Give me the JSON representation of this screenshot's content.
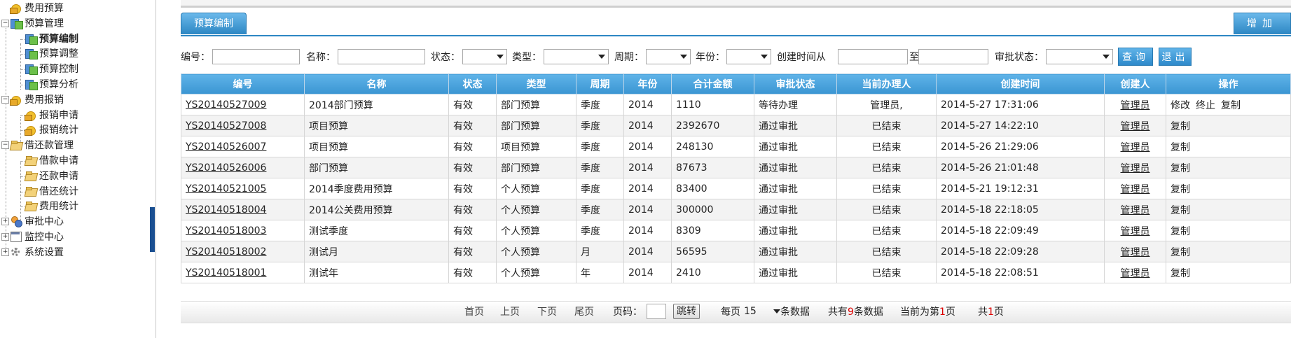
{
  "sidebar": {
    "nodes": [
      {
        "label": "费用预算",
        "icon": "coins-icon",
        "name": "tree-node-budget-root"
      },
      {
        "label": "预算管理",
        "icon": "stack-icon",
        "name": "tree-node-budget-manage"
      },
      {
        "label": "预算编制",
        "icon": "stack-icon",
        "name": "tree-node-budget-compile"
      },
      {
        "label": "预算调整",
        "icon": "stack-icon",
        "name": "tree-node-budget-adjust"
      },
      {
        "label": "预算控制",
        "icon": "stack-icon",
        "name": "tree-node-budget-control"
      },
      {
        "label": "预算分析",
        "icon": "stack-icon",
        "name": "tree-node-budget-analysis"
      },
      {
        "label": "费用报销",
        "icon": "coins-icon",
        "name": "tree-node-expense-reimburse"
      },
      {
        "label": "报销申请",
        "icon": "coins-icon",
        "name": "tree-node-reimburse-apply"
      },
      {
        "label": "报销统计",
        "icon": "coins-icon",
        "name": "tree-node-reimburse-stats"
      },
      {
        "label": "借还款管理",
        "icon": "folder-icon",
        "name": "tree-node-loan-manage"
      },
      {
        "label": "借款申请",
        "icon": "folder-icon",
        "name": "tree-node-loan-apply"
      },
      {
        "label": "还款申请",
        "icon": "folder-icon",
        "name": "tree-node-repay-apply"
      },
      {
        "label": "借还统计",
        "icon": "folder-icon",
        "name": "tree-node-loan-stats"
      },
      {
        "label": "费用统计",
        "icon": "folder-icon",
        "name": "tree-node-expense-stats"
      },
      {
        "label": "审批中心",
        "icon": "people-icon",
        "name": "tree-node-approval-center"
      },
      {
        "label": "监控中心",
        "icon": "calendar-icon",
        "name": "tree-node-monitor-center"
      },
      {
        "label": "系统设置",
        "icon": "gear-icon",
        "name": "tree-node-system-settings"
      }
    ]
  },
  "tabs": {
    "active": "预算编制",
    "add": "增加"
  },
  "filters": {
    "code_label": "编号：",
    "name_label": "名称：",
    "status_label": "状态：",
    "type_label": "类型：",
    "period_label": "周期：",
    "year_label": "年份：",
    "created_from_label": "创建时间从",
    "created_to_label": "至",
    "approval_label": "审批状态：",
    "query": "查询",
    "exit": "退出"
  },
  "table": {
    "columns": [
      "编号",
      "名称",
      "状态",
      "类型",
      "周期",
      "年份",
      "合计金额",
      "审批状态",
      "当前办理人",
      "创建时间",
      "创建人",
      "操作"
    ],
    "rows": [
      {
        "code": "YS20140527009",
        "name": "2014部门预算",
        "status": "有效",
        "type": "部门预算",
        "period": "季度",
        "year": "2014",
        "amount": "1110",
        "approval": "等待办理",
        "handler": "管理员,",
        "created": "2014-5-27 17:31:06",
        "creator": "管理员",
        "ops": [
          "修改",
          "终止",
          "复制"
        ]
      },
      {
        "code": "YS20140527008",
        "name": "项目预算",
        "status": "有效",
        "type": "部门预算",
        "period": "季度",
        "year": "2014",
        "amount": "2392670",
        "approval": "通过审批",
        "handler": "已结束",
        "created": "2014-5-27 14:22:10",
        "creator": "管理员",
        "ops": [
          "复制"
        ]
      },
      {
        "code": "YS20140526007",
        "name": "项目预算",
        "status": "有效",
        "type": "项目预算",
        "period": "季度",
        "year": "2014",
        "amount": "248130",
        "approval": "通过审批",
        "handler": "已结束",
        "created": "2014-5-26 21:29:06",
        "creator": "管理员",
        "ops": [
          "复制"
        ]
      },
      {
        "code": "YS20140526006",
        "name": "部门预算",
        "status": "有效",
        "type": "部门预算",
        "period": "季度",
        "year": "2014",
        "amount": "87673",
        "approval": "通过审批",
        "handler": "已结束",
        "created": "2014-5-26 21:01:48",
        "creator": "管理员",
        "ops": [
          "复制"
        ]
      },
      {
        "code": "YS20140521005",
        "name": "2014季度费用预算",
        "status": "有效",
        "type": "个人预算",
        "period": "季度",
        "year": "2014",
        "amount": "83400",
        "approval": "通过审批",
        "handler": "已结束",
        "created": "2014-5-21 19:12:31",
        "creator": "管理员",
        "ops": [
          "复制"
        ]
      },
      {
        "code": "YS20140518004",
        "name": "2014公关费用预算",
        "status": "有效",
        "type": "个人预算",
        "period": "季度",
        "year": "2014",
        "amount": "300000",
        "approval": "通过审批",
        "handler": "已结束",
        "created": "2014-5-18 22:18:05",
        "creator": "管理员",
        "ops": [
          "复制"
        ]
      },
      {
        "code": "YS20140518003",
        "name": "测试季度",
        "status": "有效",
        "type": "个人预算",
        "period": "季度",
        "year": "2014",
        "amount": "8309",
        "approval": "通过审批",
        "handler": "已结束",
        "created": "2014-5-18 22:09:49",
        "creator": "管理员",
        "ops": [
          "复制"
        ]
      },
      {
        "code": "YS20140518002",
        "name": "测试月",
        "status": "有效",
        "type": "个人预算",
        "period": "月",
        "year": "2014",
        "amount": "56595",
        "approval": "通过审批",
        "handler": "已结束",
        "created": "2014-5-18 22:09:28",
        "creator": "管理员",
        "ops": [
          "复制"
        ]
      },
      {
        "code": "YS20140518001",
        "name": "测试年",
        "status": "有效",
        "type": "个人预算",
        "period": "年",
        "year": "2014",
        "amount": "2410",
        "approval": "通过审批",
        "handler": "已结束",
        "created": "2014-5-18 22:08:51",
        "creator": "管理员",
        "ops": [
          "复制"
        ]
      }
    ]
  },
  "pager": {
    "first": "首页",
    "prev": "上页",
    "next": "下页",
    "last": "尾页",
    "page_label": "页码：",
    "jump": "跳转",
    "per_page_prefix": "每页",
    "page_size": "15",
    "per_page_suffix": "条数据",
    "total_prefix": "共有",
    "total": "9",
    "total_suffix": "条数据",
    "current_prefix": "当前为第",
    "current": "1",
    "current_suffix": "页",
    "pages_prefix": "共",
    "pages": "1",
    "pages_suffix": "页"
  }
}
